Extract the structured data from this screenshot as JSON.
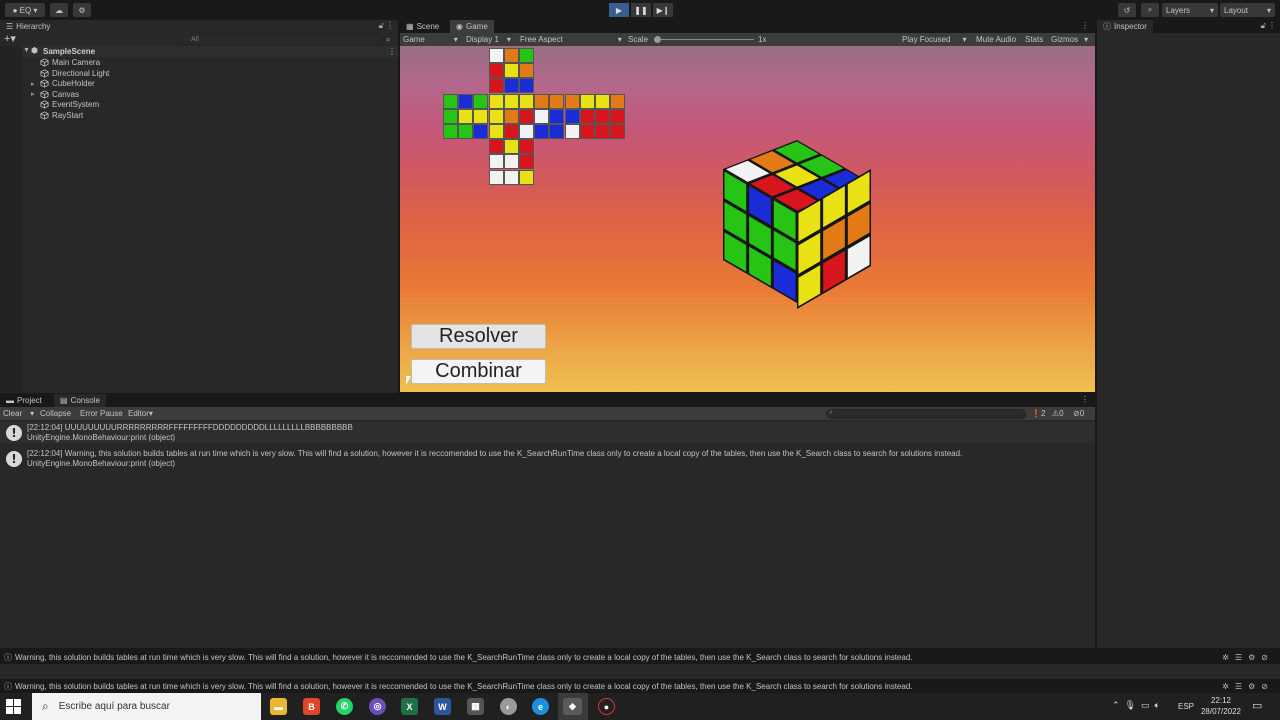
{
  "topbar": {
    "account": "EQ",
    "layers": "Layers",
    "layout": "Layout"
  },
  "hierarchy": {
    "tab": "Hierarchy",
    "search_placeholder": "All",
    "scene": "SampleScene",
    "items": [
      "Main Camera",
      "Directional Light",
      "CubeHolder",
      "Canvas",
      "EventSystem",
      "RayStart"
    ]
  },
  "view_tabs": {
    "scene": "Scene",
    "game": "Game"
  },
  "game_toolbar": {
    "mode": "Game",
    "display": "Display 1",
    "aspect": "Free Aspect",
    "scale_label": "Scale",
    "scale_value": "1x",
    "play_focused": "Play Focused",
    "mute": "Mute Audio",
    "stats": "Stats",
    "gizmos": "Gizmos"
  },
  "game_ui": {
    "resolver": "Resolver",
    "combinar": "Combinar"
  },
  "inspector": {
    "tab": "Inspector"
  },
  "bottom_tabs": {
    "project": "Project",
    "console": "Console"
  },
  "console": {
    "clear": "Clear",
    "collapse": "Collapse",
    "error_pause": "Error Pause",
    "editor": "Editor",
    "count_info": "2",
    "count_warn": "0",
    "count_error": "0",
    "logs": [
      {
        "line1": "[22:12:04] UUUUUUUUURRRRRRRRRFFFFFFFFFDDDDDDDDDLLLLLLLLLBBBBBBBBB",
        "line2": "UnityEngine.MonoBehaviour:print (object)"
      },
      {
        "line1": "[22:12:04] Warning, this solution builds tables at run time which is very slow. This will find a solution, however it is reccomended to use the K_SearchRunTime class only to create a local copy of the tables, then use the K_Search class to search for solutions instead.",
        "line2": "UnityEngine.MonoBehaviour:print (object)"
      }
    ]
  },
  "status": {
    "message": "Warning, this solution builds tables at run time which is very slow. This will find a solution, however it is reccomended to use the K_SearchRunTime class only to create a local copy of the tables, then use the K_Search class to search for solutions instead."
  },
  "taskbar": {
    "search_placeholder": "Escribe aquí para buscar",
    "lang": "ESP",
    "time": "22:12",
    "date": "28/07/2022"
  },
  "colors": {
    "white": "#f2f2f2",
    "yellow": "#e8e215",
    "red": "#d8141c",
    "orange": "#e27a16",
    "green": "#25c415",
    "blue": "#1a2cd8"
  },
  "cube_net": {
    "up": [
      [
        "W",
        "O",
        "G"
      ],
      [
        "R",
        "Y",
        "O"
      ],
      [
        "R",
        "B",
        "B"
      ]
    ],
    "left": [
      [
        "G",
        "B",
        "G"
      ],
      [
        "G",
        "Y",
        "Y"
      ],
      [
        "G",
        "G",
        "B"
      ]
    ],
    "front": [
      [
        "Y",
        "Y",
        "Y"
      ],
      [
        "Y",
        "O",
        "R"
      ],
      [
        "Y",
        "R",
        "W"
      ]
    ],
    "right": [
      [
        "O",
        "O",
        "O"
      ],
      [
        "W",
        "B",
        "B"
      ],
      [
        "B",
        "B",
        "W"
      ]
    ],
    "back": [
      [
        "Y",
        "Y",
        "O"
      ],
      [
        "R",
        "R",
        "R"
      ],
      [
        "R",
        "R",
        "R"
      ]
    ],
    "down": [
      [
        "R",
        "Y",
        "R"
      ],
      [
        "W",
        "W",
        "R"
      ],
      [
        "W",
        "W",
        "Y"
      ]
    ]
  },
  "cube3d": {
    "top": [
      [
        "W",
        "O",
        "G"
      ],
      [
        "R",
        "Y",
        "G"
      ],
      [
        "R",
        "B",
        "B"
      ]
    ],
    "left": [
      [
        "G",
        "B",
        "G"
      ],
      [
        "G",
        "G",
        "G"
      ],
      [
        "G",
        "G",
        "B"
      ]
    ],
    "right": [
      [
        "Y",
        "Y",
        "Y"
      ],
      [
        "Y",
        "O",
        "O"
      ],
      [
        "Y",
        "R",
        "W"
      ]
    ]
  }
}
